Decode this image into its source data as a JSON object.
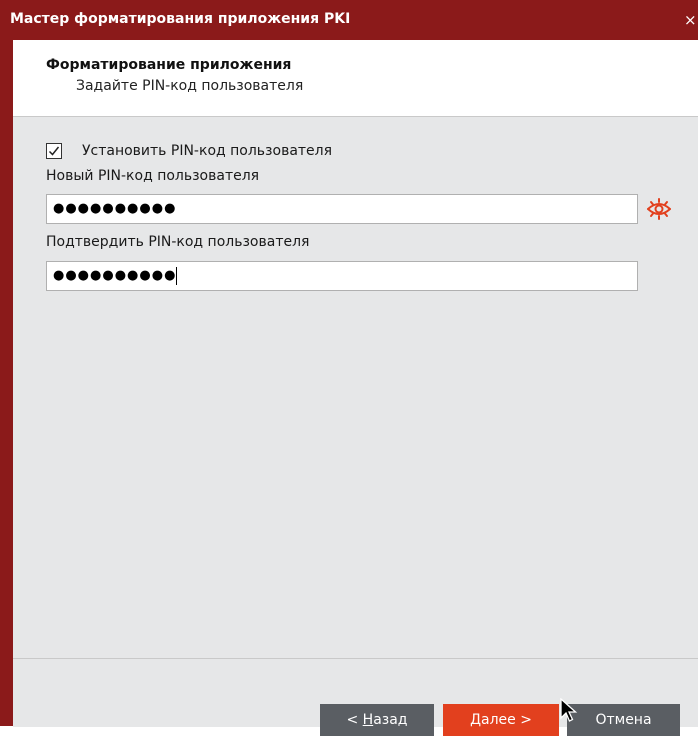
{
  "window": {
    "title": "Мастер форматирования приложения PKI",
    "close_symbol": "×",
    "colors": {
      "titlebar": "#8b1a1a",
      "accent": "#e2401e",
      "secondary_button": "#5a5e63"
    }
  },
  "header": {
    "title": "Форматирование приложения",
    "subtitle": "Задайте PIN-код пользователя"
  },
  "form": {
    "set_pin_checkbox": {
      "label": "Установить PIN-код пользователя",
      "checked": true
    },
    "new_pin": {
      "label": "Новый PIN-код пользователя",
      "value": "●●●●●●●●●●"
    },
    "confirm_pin": {
      "label": "Подтвердить PIN-код пользователя",
      "value": "●●●●●●●●●●"
    },
    "show_password_icon": "eye-icon"
  },
  "footer": {
    "back_prefix": "< ",
    "back_mnemonic": "Н",
    "back_rest": "азад",
    "next_mnemonic": "Д",
    "next_rest": "алее >",
    "cancel_label": "Отмена"
  }
}
